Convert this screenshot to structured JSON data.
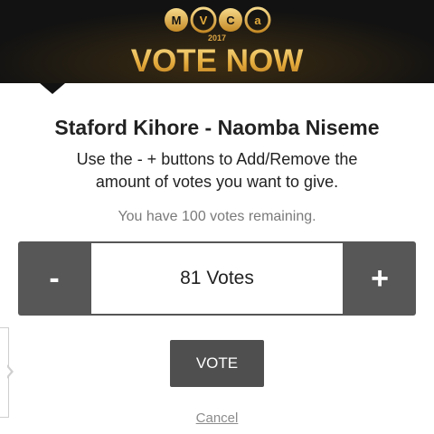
{
  "header": {
    "logo_text": "MVCA",
    "logo_year": "2017",
    "title": "VOTE NOW"
  },
  "candidate": {
    "title": "Staford Kihore - Naomba Niseme"
  },
  "instructions": {
    "line1": "Use the - + buttons to Add/Remove the",
    "line2": "amount of votes you want to give."
  },
  "remaining_text": "You have 100 votes remaining.",
  "stepper": {
    "minus_label": "-",
    "plus_label": "+",
    "count_text": "81 Votes",
    "votes": 81,
    "max_votes": 100
  },
  "actions": {
    "vote_label": "VOTE",
    "cancel_label": "Cancel"
  },
  "colors": {
    "banner_bg": "#121212",
    "gold": "#e4ab3c",
    "button_gray": "#575757"
  }
}
